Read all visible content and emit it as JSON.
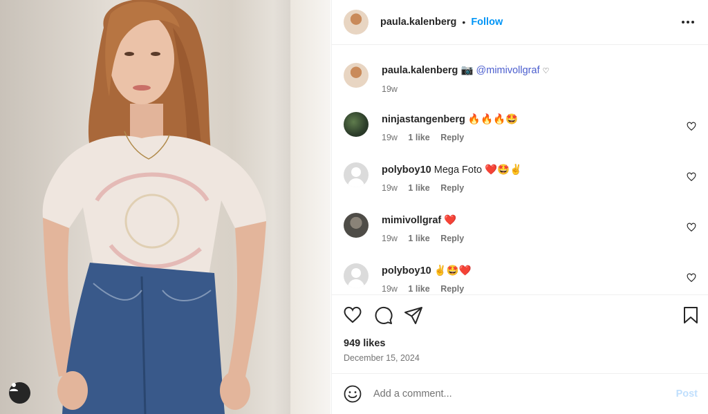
{
  "post": {
    "author": "paula.kalenberg",
    "follow_label": "Follow",
    "separator": "•",
    "likes": "949 likes",
    "date": "December 15, 2024"
  },
  "caption": {
    "username": "paula.kalenberg",
    "camera_glyph": "📷",
    "mention": "@mimivollgraf",
    "small_heart": "♡",
    "time": "19w"
  },
  "comments": [
    {
      "username": "ninjastangenberg",
      "text": "🔥🔥🔥🤩",
      "time": "19w",
      "likes": "1 like",
      "reply": "Reply"
    },
    {
      "username": "polyboy10",
      "text": "Mega Foto ❤️🤩✌️",
      "time": "19w",
      "likes": "1 like",
      "reply": "Reply"
    },
    {
      "username": "mimivollgraf",
      "text": "❤️",
      "time": "19w",
      "likes": "1 like",
      "reply": "Reply"
    },
    {
      "username": "polyboy10",
      "text": "✌️🤩❤️",
      "time": "19w",
      "likes": "1 like",
      "reply": "Reply"
    }
  ],
  "composer": {
    "placeholder": "Add a comment...",
    "post_label": "Post"
  },
  "colors": {
    "link_blue": "#0095f6",
    "secondary_text": "#737373",
    "post_disabled": "#c0dffd"
  },
  "icons": [
    "heart-icon",
    "comment-icon",
    "share-icon",
    "bookmark-icon",
    "more-options-icon",
    "emoji-icon",
    "user-icon"
  ]
}
